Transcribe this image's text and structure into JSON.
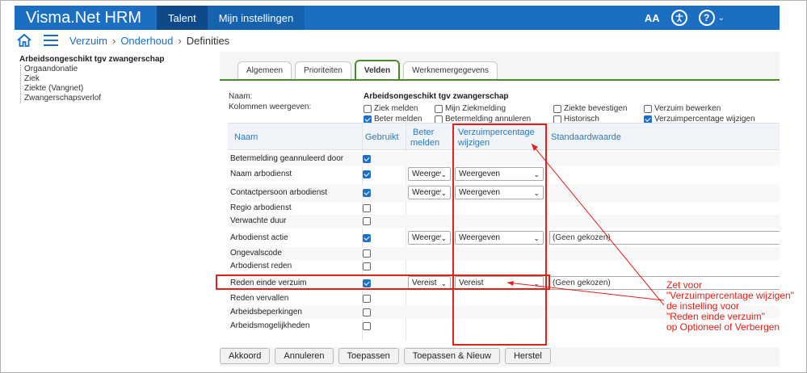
{
  "header": {
    "app_title": "Visma.Net HRM",
    "nav": [
      "Talent",
      "Mijn instellingen"
    ],
    "font_size_label": "AA",
    "accessibility_icon": "accessibility-icon",
    "help_icon": "help-icon",
    "help_label": "?",
    "colors": {
      "bar": "#1b6ec2",
      "active_tab": "#0e4a8a"
    }
  },
  "breadcrumb": {
    "items": [
      "Verzuim",
      "Onderhoud"
    ],
    "current": "Definities",
    "sep": "›"
  },
  "tree": {
    "items": [
      "Arbeidsongeschikt tgv zwangerschap",
      "Orgaandonatie",
      "Ziek",
      "Ziekte (Vangnet)",
      "Zwangerschapsverlof"
    ]
  },
  "tabs": [
    "Algemeen",
    "Prioriteiten",
    "Velden",
    "Werknemergegevens"
  ],
  "form": {
    "name_label": "Naam:",
    "name_value": "Arbeidsongeschikt tgv zwangerschap",
    "columns_label": "Kolommen weergeven:",
    "column_options": [
      {
        "label": "Ziek melden",
        "checked": false
      },
      {
        "label": "Mijn Ziekmelding",
        "checked": false
      },
      {
        "label": "Ziekte bevestigen",
        "checked": false
      },
      {
        "label": "Verzuim bewerken",
        "checked": false
      },
      {
        "label": "Beter melden",
        "checked": true
      },
      {
        "label": "Betermelding annuleren",
        "checked": false
      },
      {
        "label": "Historisch",
        "checked": false
      },
      {
        "label": "Verzuimpercentage wijzigen",
        "checked": true
      }
    ]
  },
  "grid": {
    "headers": {
      "naam": "Naam",
      "gebruikt": "Gebruikt",
      "beter_1": "Beter",
      "beter_2": "melden",
      "verz_1": "Verzuimpercentage",
      "verz_2": "wijzigen",
      "standaard": "Standaardwaarde"
    },
    "rows": [
      {
        "name": "Betermelding geannuleerd door",
        "used": true,
        "beter": "",
        "verz": "",
        "def": ""
      },
      {
        "name": "Naam arbodienst",
        "used": true,
        "beter": "Weergeven",
        "verz": "Weergeven",
        "def": ""
      },
      {
        "name": "Contactpersoon arbodienst",
        "used": true,
        "beter": "Weergeven",
        "verz": "Weergeven",
        "def": ""
      },
      {
        "name": "Regio arbodienst",
        "used": false,
        "beter": "",
        "verz": "",
        "def": ""
      },
      {
        "name": "Verwachte duur",
        "used": false,
        "beter": "",
        "verz": "",
        "def": ""
      },
      {
        "name": "Arbodienst actie",
        "used": true,
        "beter": "Weergeven",
        "verz": "Weergeven",
        "def": "(Geen gekozen)"
      },
      {
        "name": "Ongevalscode",
        "used": false,
        "beter": "",
        "verz": "",
        "def": ""
      },
      {
        "name": "Arbodienst reden",
        "used": false,
        "beter": "",
        "verz": "",
        "def": ""
      },
      {
        "name": "Reden einde verzuim",
        "used": true,
        "beter": "Vereist",
        "verz": "Vereist",
        "def": "(Geen gekozen)"
      },
      {
        "name": "Reden vervallen",
        "used": false,
        "beter": "",
        "verz": "",
        "def": ""
      },
      {
        "name": "Arbeidsbeperkingen",
        "used": false,
        "beter": "",
        "verz": "",
        "def": ""
      },
      {
        "name": "Arbeidsmogelijkheden",
        "used": false,
        "beter": "",
        "verz": "",
        "def": ""
      }
    ]
  },
  "annotation": {
    "lines": [
      "Zet voor",
      "\"Verzuimpercentage wijzigen\"",
      "de instelling voor",
      "\"Reden einde verzuim\"",
      "op Optioneel of Verbergen"
    ],
    "color": "#e0201a"
  },
  "buttons": [
    "Akkoord",
    "Annuleren",
    "Toepassen",
    "Toepassen & Nieuw",
    "Herstel"
  ]
}
